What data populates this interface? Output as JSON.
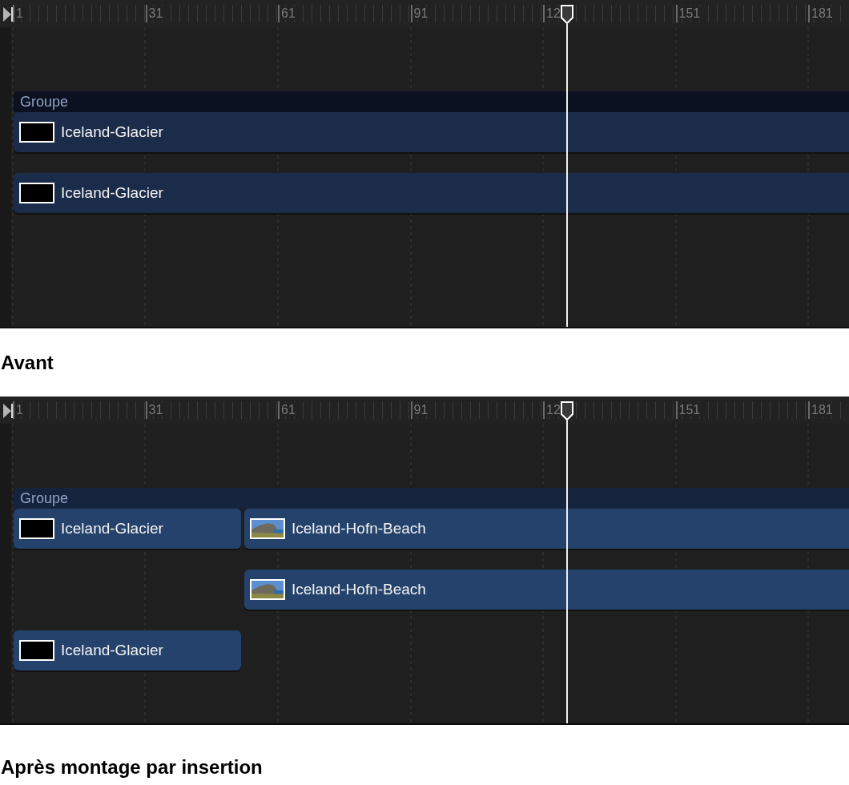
{
  "panels": [
    {
      "ruler": [
        "1",
        "31",
        "61",
        "91",
        "12",
        "151",
        "181"
      ],
      "group": {
        "label": "Groupe",
        "selected": false
      },
      "tracks": [
        {
          "span": {
            "label": "Iceland-Glacier",
            "kind": "blank",
            "selected": false
          }
        },
        {
          "span": {
            "label": "Iceland-Glacier",
            "kind": "blank",
            "selected": false
          }
        }
      ],
      "caption": "Avant"
    },
    {
      "ruler": [
        "1",
        "31",
        "61",
        "91",
        "12",
        "151",
        "181"
      ],
      "group": {
        "label": "Groupe",
        "selected": true
      },
      "tracks": [
        {
          "left": {
            "label": "Iceland-Glacier",
            "kind": "blank",
            "selected": true
          },
          "right": {
            "label": "Iceland-Hofn-Beach",
            "kind": "picture",
            "selected": true
          }
        },
        {
          "right": {
            "label": "Iceland-Hofn-Beach",
            "kind": "picture",
            "selected": true
          }
        },
        {
          "left": {
            "label": "Iceland-Glacier",
            "kind": "blank",
            "selected": true
          }
        }
      ],
      "caption": "Après montage par insertion"
    }
  ]
}
